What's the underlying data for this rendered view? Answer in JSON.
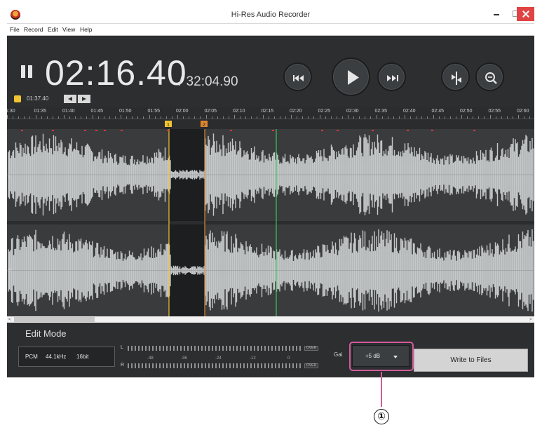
{
  "window": {
    "title": "Hi-Res Audio Recorder"
  },
  "menu": [
    "File",
    "Record",
    "Edit",
    "View",
    "Help"
  ],
  "transport": {
    "current_time": "02:16.40",
    "total_time": "/ 32:04.90",
    "marker_time": "01:37.40",
    "buttons": [
      "pause-icon",
      "previous-track-icon",
      "play-icon",
      "next-track-icon",
      "cut-icon",
      "zoom-out-icon"
    ]
  },
  "ruler": {
    "labels": [
      "1:30",
      "01:35",
      "01:40",
      "01:45",
      "01:50",
      "01:55",
      "02:00",
      "02:05",
      "02:10",
      "02:15",
      "02:20",
      "02:25",
      "02:30",
      "02:35",
      "02:40",
      "02:45",
      "02:50",
      "02:55",
      "02:60"
    ]
  },
  "markers": [
    "1",
    "2"
  ],
  "channels": [
    "L",
    "R"
  ],
  "bottom": {
    "mode_title": "Edit Mode",
    "format": [
      "PCM",
      "44.1kHz",
      "16bit"
    ],
    "meter_channels": [
      "L",
      "R"
    ],
    "meter_scale": [
      "-48",
      "-36",
      "-24",
      "-12",
      "0"
    ],
    "meter_peak": [
      "OVER",
      "OVER"
    ],
    "gain_label": "Gai",
    "gain_value": "+5 dB",
    "write_button": "Write to Files"
  },
  "callout": "①",
  "colors": {
    "accent_highlight": "#d35a9b",
    "marker_yellow": "#f1c431",
    "marker_orange": "#e0852f",
    "playhead": "#3bc45a",
    "wave": "#c5c8c9"
  }
}
